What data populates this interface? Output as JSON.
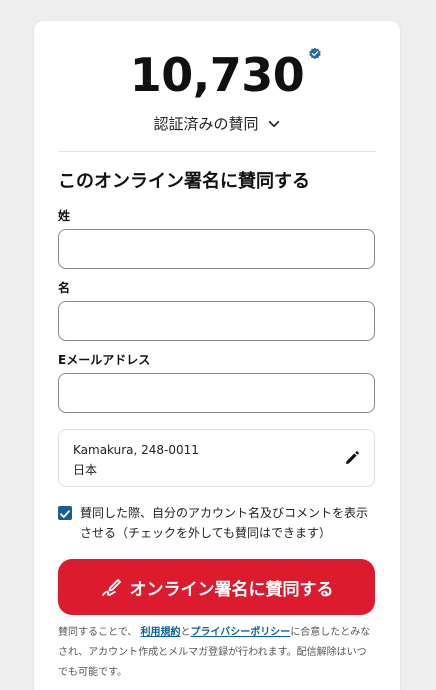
{
  "counter": {
    "count": "10,730",
    "label": "認証済みの賛同"
  },
  "form": {
    "heading": "このオンライン署名に賛同する",
    "last_name_label": "姓",
    "first_name_label": "名",
    "email_label": "Eメールアドレス",
    "last_name_value": "",
    "first_name_value": "",
    "email_value": ""
  },
  "address": {
    "line1": "Kamakura, 248-0011",
    "line2": "日本"
  },
  "consent": {
    "checked": true,
    "text": "賛同した際、自分のアカウント名及びコメントを表示させる（チェックを外しても賛同はできます）"
  },
  "submit": {
    "label": "オンライン署名に賛同する"
  },
  "legal": {
    "prefix": "賛同することで、",
    "terms_link": "利用規約",
    "and": "と",
    "privacy_link": "プライバシーポリシー",
    "suffix": "に合意したとみなされ、アカウント作成とメルマガ登録が行われます。配信解除はいつでも可能です。"
  },
  "colors": {
    "accent": "#dc1c2e",
    "link": "#0b5f9a",
    "checkbox": "#1d5c8c"
  },
  "icons": [
    "verified-badge-icon",
    "chevron-down-icon",
    "pencil-edit-icon",
    "signature-pen-icon",
    "checkmark-icon"
  ]
}
